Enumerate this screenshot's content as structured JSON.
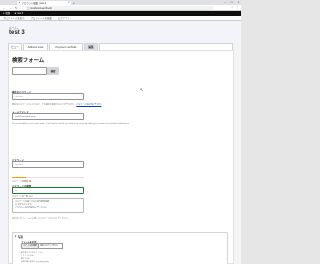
{
  "browser": {
    "tab_title": "アカウント編集 | test 3",
    "tab_close": "×",
    "new_tab": "+",
    "window_controls": [
      "–",
      "□",
      "×"
    ],
    "nav": [
      "←",
      "→",
      "↻"
    ],
    "url": "localhost/user/3/edit",
    "right_icons": [
      "☆",
      "⋮"
    ]
  },
  "toolbar": {
    "items": [
      {
        "icon": "≡",
        "label": "管理"
      },
      {
        "icon": "★",
        "label": "test 3"
      }
    ]
  },
  "subbar": {
    "items": [
      "プロフィールを表示",
      "プロフィールを編集",
      "ログアウト"
    ]
  },
  "page": {
    "breadcrumb": "ホーム  ›",
    "title": "test 3",
    "tabs": [
      {
        "label": "ビュー",
        "active": false
      },
      {
        "label": "Address book",
        "active": false
      },
      {
        "label": "Payment methods",
        "active": false
      },
      {
        "label": "編集",
        "active": true
      }
    ]
  },
  "form": {
    "heading": "検索フォーム",
    "search_button": "検索",
    "cursor": "↖",
    "current_password": {
      "label": "現在のパスワード",
      "value": "",
      "placeholder": "••••••••••",
      "desc_before": "現在のパスワードを入力すると、下の項目を変更することができます。",
      "desc_link": "パスワードをお忘れですか?"
    },
    "email": {
      "label": "メールアドレス",
      "value": "test3@example.co.jp",
      "desc": "The email address is not made public. It will only be used if you need to be contacted about your account or for opted-in notifications."
    },
    "password": {
      "label": "パスワード",
      "value": "••••••••••",
      "strength_label": "パスワードの強度:",
      "strength_value": "弱",
      "strength_fraction": 0.19
    },
    "password_confirm": {
      "label": "パスワードの確認",
      "value": "•••",
      "match_label": "パスワードの一致:",
      "match_value": "はい"
    },
    "tips": [
      "パスワードを強くするための推奨事項:",
      "12 文字以上にする",
      "アカウント名を含めないでください"
    ],
    "password_desc": "両方の入力フィールドに新しいパスワードを入力してください。",
    "picture": {
      "summary_icon": "▾",
      "summary": "写真",
      "file_label": "ファイルを追加",
      "choose_button": "ファイルを選択",
      "no_file": "選択されていません",
      "desc_lines": [
        "顔写真やカスタムアイコン。",
        "1 ファイルのみ。",
        "最大 2 MB。",
        "使用可能な拡張子: png gif jpg jpeg"
      ]
    }
  }
}
